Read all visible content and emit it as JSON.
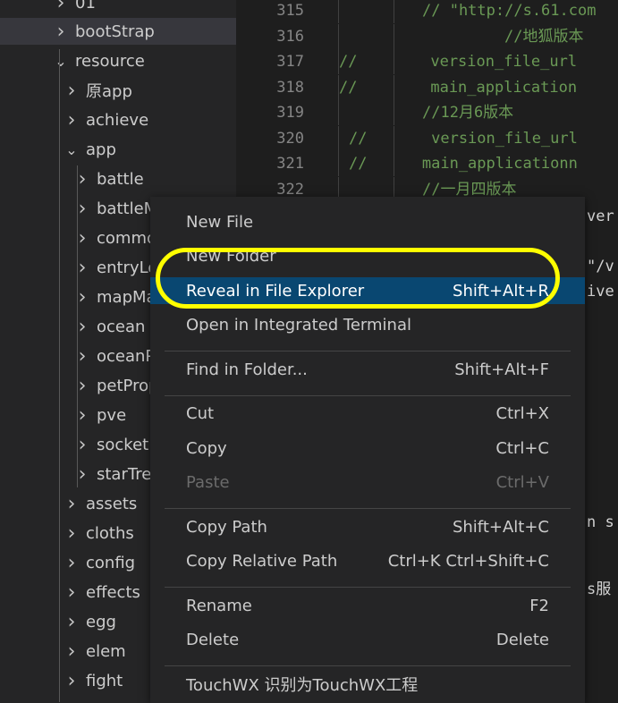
{
  "sidebar": {
    "items": [
      {
        "label": "01",
        "depth": 1,
        "chevron": "right"
      },
      {
        "label": "bootStrap",
        "depth": 1,
        "chevron": "right",
        "selected": true
      },
      {
        "label": "resource",
        "depth": 1,
        "chevron": "down"
      },
      {
        "label": "原app",
        "depth": 2,
        "chevron": "right"
      },
      {
        "label": "achieve",
        "depth": 2,
        "chevron": "right"
      },
      {
        "label": "app",
        "depth": 2,
        "chevron": "down"
      },
      {
        "label": "battle",
        "depth": 3,
        "chevron": "right"
      },
      {
        "label": "battleM",
        "depth": 3,
        "chevron": "right"
      },
      {
        "label": "commo",
        "depth": 3,
        "chevron": "right"
      },
      {
        "label": "entryLo",
        "depth": 3,
        "chevron": "right"
      },
      {
        "label": "mapMa",
        "depth": 3,
        "chevron": "right"
      },
      {
        "label": "ocean",
        "depth": 3,
        "chevron": "right"
      },
      {
        "label": "oceanP",
        "depth": 3,
        "chevron": "right"
      },
      {
        "label": "petProp",
        "depth": 3,
        "chevron": "right"
      },
      {
        "label": "pve",
        "depth": 3,
        "chevron": "right"
      },
      {
        "label": "socket",
        "depth": 3,
        "chevron": "right"
      },
      {
        "label": "starTrel",
        "depth": 3,
        "chevron": "right"
      },
      {
        "label": "assets",
        "depth": 2,
        "chevron": "right"
      },
      {
        "label": "cloths",
        "depth": 2,
        "chevron": "right"
      },
      {
        "label": "config",
        "depth": 2,
        "chevron": "right"
      },
      {
        "label": "effects",
        "depth": 2,
        "chevron": "right"
      },
      {
        "label": "egg",
        "depth": 2,
        "chevron": "right"
      },
      {
        "label": "elem",
        "depth": 2,
        "chevron": "right"
      },
      {
        "label": "fight",
        "depth": 2,
        "chevron": "right"
      }
    ]
  },
  "editor": {
    "lines": [
      {
        "num": "315",
        "text": "// \"http://s.61.com",
        "style": "comment"
      },
      {
        "num": "316",
        "text": "//地狐版本",
        "style": "comment"
      },
      {
        "num": "317",
        "text": "//        version_file_url",
        "style": "comment"
      },
      {
        "num": "318",
        "text": "//        main_application",
        "style": "comment"
      },
      {
        "num": "319",
        "text": "//12月6版本",
        "style": "comment"
      },
      {
        "num": "320",
        "text": "//       version_file_url",
        "style": "comment"
      },
      {
        "num": "321",
        "text": "//      main_applicationn",
        "style": "comment"
      },
      {
        "num": "322",
        "text": "//一月四版本",
        "style": "comment"
      }
    ],
    "fragments": [
      "ver",
      "\"/v",
      "ive",
      "n s",
      "s服"
    ]
  },
  "context_menu": {
    "groups": [
      [
        {
          "label": "New File",
          "shortcut": ""
        },
        {
          "label": "New Folder",
          "shortcut": ""
        },
        {
          "label": "Reveal in File Explorer",
          "shortcut": "Shift+Alt+R",
          "active": true
        },
        {
          "label": "Open in Integrated Terminal",
          "shortcut": ""
        }
      ],
      [
        {
          "label": "Find in Folder...",
          "shortcut": "Shift+Alt+F"
        }
      ],
      [
        {
          "label": "Cut",
          "shortcut": "Ctrl+X"
        },
        {
          "label": "Copy",
          "shortcut": "Ctrl+C"
        },
        {
          "label": "Paste",
          "shortcut": "Ctrl+V",
          "disabled": true
        }
      ],
      [
        {
          "label": "Copy Path",
          "shortcut": "Shift+Alt+C"
        },
        {
          "label": "Copy Relative Path",
          "shortcut": "Ctrl+K Ctrl+Shift+C"
        }
      ],
      [
        {
          "label": "Rename",
          "shortcut": "F2"
        },
        {
          "label": "Delete",
          "shortcut": "Delete"
        }
      ],
      [
        {
          "label": "TouchWX 识别为TouchWX工程",
          "shortcut": ""
        }
      ]
    ]
  },
  "colors": {
    "highlight": "#ffff00",
    "menu_active": "#094771",
    "comment": "#6a9955"
  }
}
